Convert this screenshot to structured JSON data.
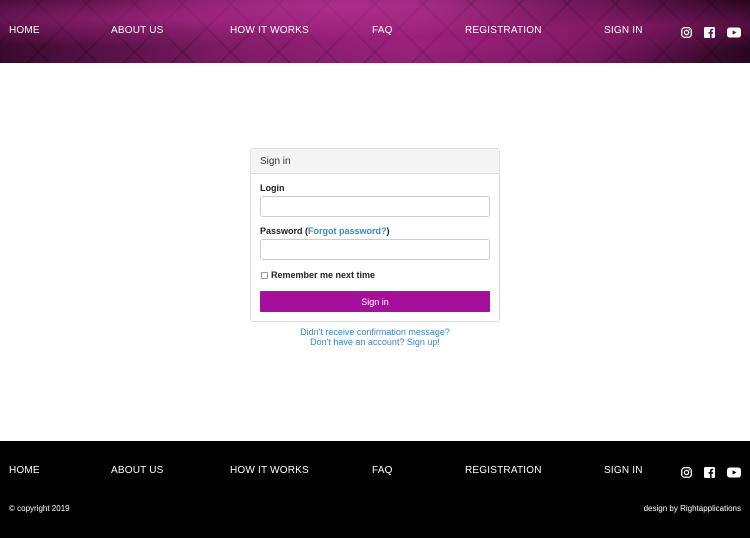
{
  "nav": {
    "home": "HOME",
    "about": "ABOUT US",
    "how": "HOW IT WORKS",
    "faq": "FAQ",
    "registration": "REGISTRATION",
    "signin": "SIGN IN"
  },
  "social_icons": [
    "instagram-icon",
    "facebook-icon",
    "youtube-icon"
  ],
  "signin_panel": {
    "heading": "Sign in",
    "login_label": "Login",
    "login_value": "",
    "password_label": "Password",
    "password_open": "(",
    "forgot_link": "Forgot password?",
    "password_close": ")",
    "password_value": "",
    "remember_label": "Remember me next time",
    "remember_checked": false,
    "submit_label": "Sign in"
  },
  "links": {
    "confirmation": "Didn't receive confirmation message?",
    "signup": "Don't have an account? Sign up!"
  },
  "footer": {
    "copyright": "© copyright 2019",
    "credit": "design by Rightapplications"
  },
  "colors": {
    "accent": "#a50f9b",
    "link": "#3a88c8",
    "footer_bg": "#000000"
  }
}
